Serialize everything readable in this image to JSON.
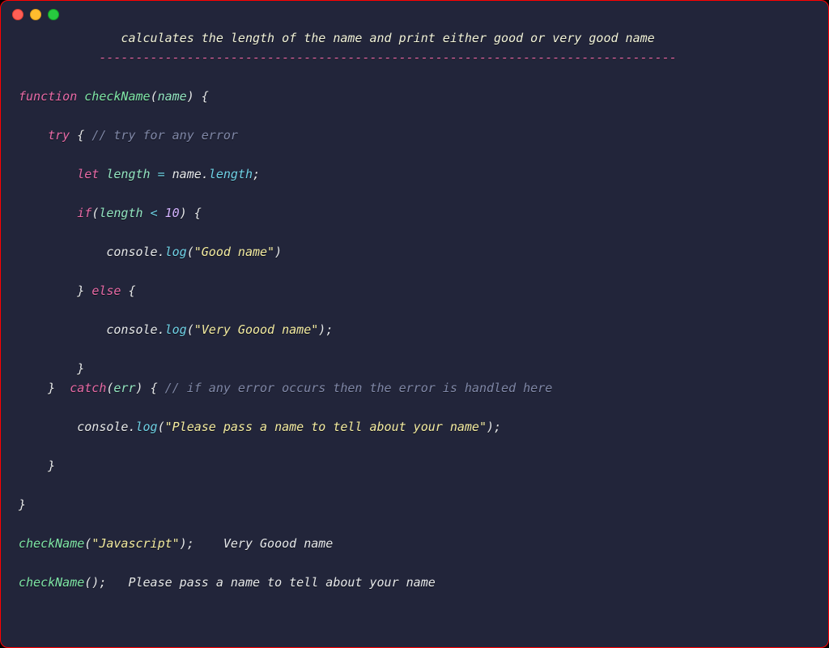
{
  "header": {
    "description": "calculates the length of the name and print either good or very good name",
    "divider": "-------------------------------------------------------------------------------"
  },
  "code": {
    "kw_function": "function",
    "fn_name": "checkName",
    "param_name": "name",
    "kw_try": "try",
    "comment_try": "// try for any error",
    "kw_let": "let",
    "var_length": "length",
    "op_assign": "=",
    "expr_obj": "name",
    "expr_prop": "length",
    "kw_if": "if",
    "cond_lhs": "length",
    "op_lt": "<",
    "cond_rhs": "10",
    "console": "console",
    "log": "log",
    "str_good": "\"Good name\"",
    "kw_else": "else",
    "str_verygood": "\"Very Goood name\"",
    "kw_catch": "catch",
    "param_err": "err",
    "comment_catch": "// if any error occurs then the error is handled here",
    "str_please": "\"Please pass a name to tell about your name\"",
    "call1": "checkName",
    "call1_arg": "\"Javascript\"",
    "call1_out": "Very Goood name",
    "call2": "checkName",
    "call2_out": "Please pass a name to tell about your name"
  }
}
